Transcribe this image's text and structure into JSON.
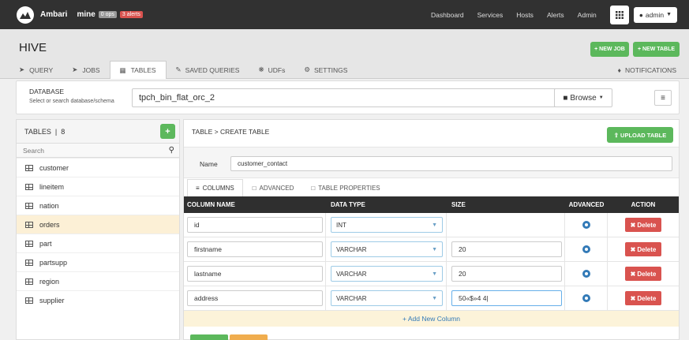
{
  "topbar": {
    "brand": "Ambari",
    "cluster": "mine",
    "ops_badge": "0 ops",
    "alerts_badge": "3 alerts",
    "nav": [
      "Dashboard",
      "Services",
      "Hosts",
      "Alerts",
      "Admin"
    ],
    "user": "admin",
    "colors": {
      "bg": "#313131",
      "alert": "#d9534f"
    }
  },
  "header": {
    "title": "HIVE",
    "new_job": "+ NEW JOB",
    "new_table": "+ NEW TABLE",
    "tabs": [
      {
        "icon": "paper-plane-icon",
        "label": "QUERY"
      },
      {
        "icon": "paper-plane-icon",
        "label": "JOBS"
      },
      {
        "icon": "table-icon",
        "label": "TABLES"
      },
      {
        "icon": "pencil-icon",
        "label": "SAVED QUERIES"
      },
      {
        "icon": "puzzle-icon",
        "label": "UDFs"
      },
      {
        "icon": "gear-icon",
        "label": "SETTINGS"
      }
    ],
    "notifications": "NOTIFICATIONS"
  },
  "database": {
    "label": "DATABASE",
    "sublabel": "Select or search database/schema",
    "value": "tpch_bin_flat_orc_2",
    "browse": "Browse"
  },
  "tables_panel": {
    "title": "TABLES",
    "count": "8",
    "search_placeholder": "Search",
    "items": [
      "customer",
      "lineitem",
      "nation",
      "orders",
      "part",
      "partsupp",
      "region",
      "supplier"
    ],
    "selected": "orders"
  },
  "create": {
    "breadcrumb": "TABLE > CREATE TABLE",
    "upload_button": "UPLOAD TABLE",
    "name_label": "Name",
    "name_value": "customer_contact",
    "subtabs": [
      "COLUMNS",
      "ADVANCED",
      "TABLE PROPERTIES"
    ],
    "columns_header": [
      "COLUMN NAME",
      "DATA TYPE",
      "SIZE",
      "ADVANCED",
      "ACTION"
    ],
    "rows": [
      {
        "name": "id",
        "type": "INT",
        "size": null
      },
      {
        "name": "firstname",
        "type": "VARCHAR",
        "size": "20"
      },
      {
        "name": "lastname",
        "type": "VARCHAR",
        "size": "20"
      },
      {
        "name": "address",
        "type": "VARCHAR",
        "size": "50«$»4 4|"
      }
    ],
    "delete_label": "Delete",
    "add_column": "+ Add New Column"
  }
}
